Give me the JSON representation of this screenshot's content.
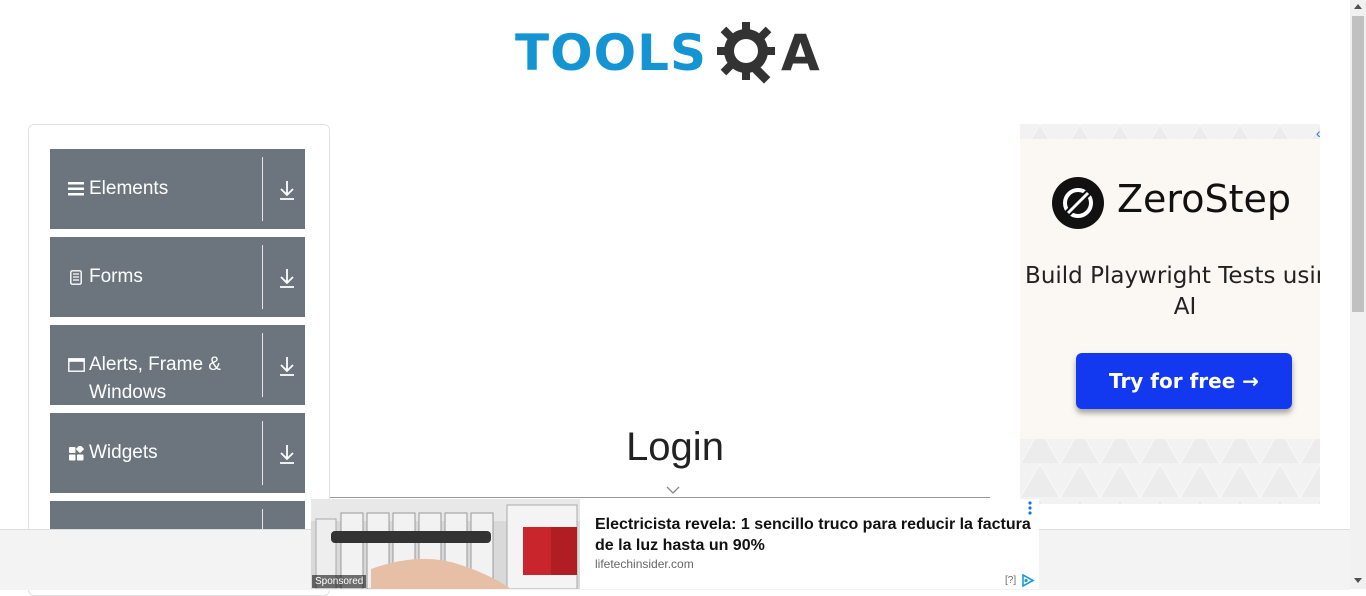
{
  "header": {
    "logo_tools": "TOOLS",
    "logo_a": "A",
    "brand_color": "#1594d4"
  },
  "sidebar": {
    "items": [
      {
        "label": "Elements",
        "icon": "hamburger-icon"
      },
      {
        "label": "Forms",
        "icon": "document-icon"
      },
      {
        "label": "Alerts, Frame & Windows",
        "icon": "window-icon"
      },
      {
        "label": "Widgets",
        "icon": "widgets-icon"
      },
      {
        "label": "",
        "icon": ""
      }
    ],
    "group_color": "#6c757d"
  },
  "main": {
    "title": "Login"
  },
  "ad_right": {
    "brand": "ZeroStep",
    "tagline": "Build Playwright Tests using AI",
    "cta": "Try for free →",
    "back_icon": "‹",
    "cta_color": "#1238f0"
  },
  "sponsored": {
    "label": "Sponsored",
    "title": "Electricista revela: 1 sencillo truco para reducir la factura de la luz hasta un 90%",
    "domain": "lifetechinsider.com",
    "info": "[?]"
  }
}
